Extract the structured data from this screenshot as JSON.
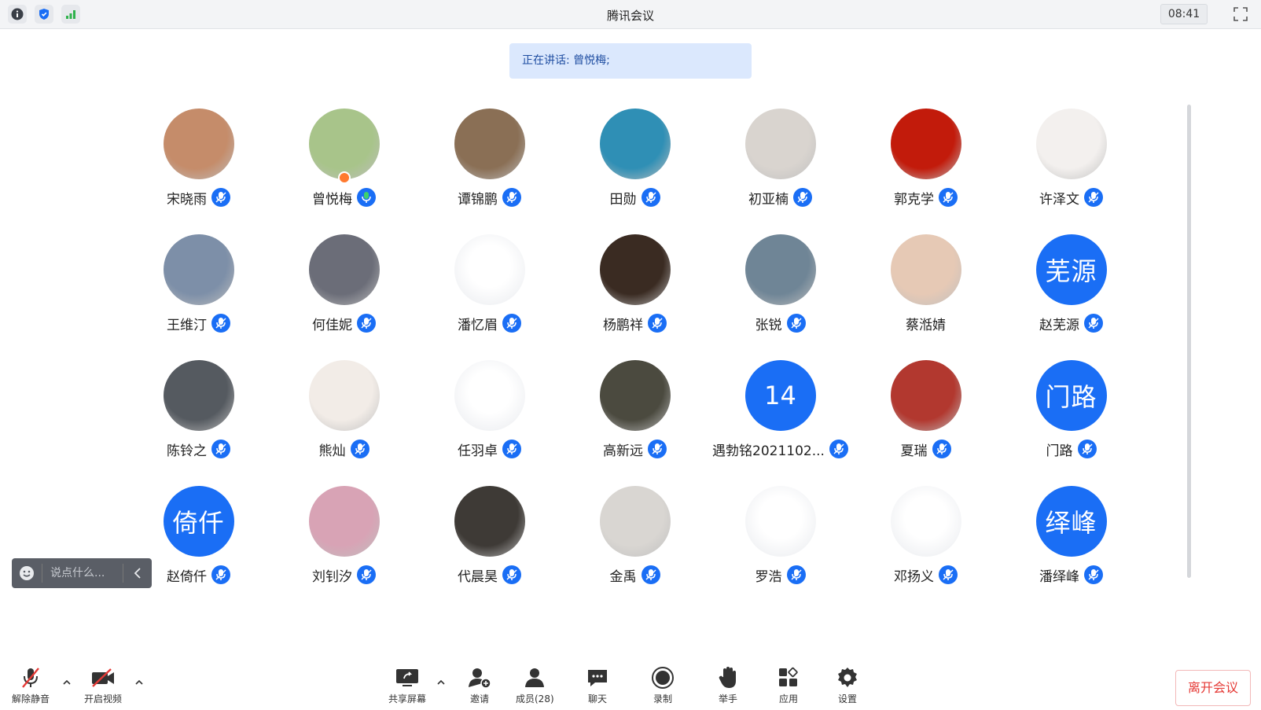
{
  "window": {
    "title": "腾讯会议",
    "clock": "08:41",
    "icons": [
      "info-icon",
      "shield-icon",
      "signal-icon",
      "fullscreen-icon"
    ]
  },
  "speaking": {
    "text": "正在讲话: 曾悦梅;"
  },
  "participants": [
    {
      "name": "宋晓雨",
      "avatar": "photo",
      "color": "#c58c6a"
    },
    {
      "name": "曾悦梅",
      "avatar": "photo",
      "color": "#a8c48a",
      "host": true
    },
    {
      "name": "谭锦鹏",
      "avatar": "photo",
      "color": "#8a6f55"
    },
    {
      "name": "田勋",
      "avatar": "photo",
      "color": "#2f8fb5"
    },
    {
      "name": "初亚楠",
      "avatar": "photo",
      "color": "#d9d4cf"
    },
    {
      "name": "郭克学",
      "avatar": "photo",
      "color": "#c21b0b"
    },
    {
      "name": "许泽文",
      "avatar": "photo",
      "color": "#f3f0ee"
    },
    {
      "name": "王维汀",
      "avatar": "photo",
      "color": "#7d8fa8"
    },
    {
      "name": "何佳妮",
      "avatar": "photo",
      "color": "#6b6d78"
    },
    {
      "name": "潘忆眉",
      "avatar": "photo",
      "color": "#f1f1f1"
    },
    {
      "name": "杨鹏祥",
      "avatar": "photo",
      "color": "#3a2b22"
    },
    {
      "name": "张锐",
      "avatar": "photo",
      "color": "#6f8596"
    },
    {
      "name": "蔡湉婧",
      "avatar": "photo",
      "color": "#e6c9b5"
    },
    {
      "name": "赵芜源",
      "avatar": "text",
      "text": "芜源",
      "color": "#1a6ef5"
    },
    {
      "name": "陈铃之",
      "avatar": "photo",
      "color": "#555a60"
    },
    {
      "name": "熊灿",
      "avatar": "photo",
      "color": "#f2ece7"
    },
    {
      "name": "任羽卓",
      "avatar": "photo",
      "color": "#ffffff"
    },
    {
      "name": "高新远",
      "avatar": "photo",
      "color": "#4b4a3f"
    },
    {
      "name": "遇勃铭2021102...",
      "avatar": "text",
      "text": "14",
      "color": "#1a6ef5"
    },
    {
      "name": "夏瑞",
      "avatar": "photo",
      "color": "#b2382f"
    },
    {
      "name": "门路",
      "avatar": "text",
      "text": "门路",
      "color": "#1a6ef5"
    },
    {
      "name": "赵倚仟",
      "avatar": "text",
      "text": "倚仟",
      "color": "#1a6ef5"
    },
    {
      "name": "刘钊汐",
      "avatar": "photo",
      "color": "#d8a3b5"
    },
    {
      "name": "代晨昊",
      "avatar": "photo",
      "color": "#3e3a36"
    },
    {
      "name": "金禹",
      "avatar": "photo",
      "color": "#d9d6d2"
    },
    {
      "name": "罗浩",
      "avatar": "photo",
      "color": "#ffffff"
    },
    {
      "name": "邓扬义",
      "avatar": "photo",
      "color": "#ffffff"
    },
    {
      "name": "潘绎峰",
      "avatar": "text",
      "text": "绎峰",
      "color": "#1a6ef5"
    }
  ],
  "chat": {
    "placeholder": "说点什么..."
  },
  "toolbar": {
    "unmute": "解除静音",
    "start_video": "开启视频",
    "share_screen": "共享屏幕",
    "invite": "邀请",
    "members": "成员(28)",
    "chat": "聊天",
    "record": "录制",
    "raise_hand": "举手",
    "apps": "应用",
    "settings": "设置",
    "leave": "离开会议"
  },
  "colors": {
    "accent": "#1a6ef5",
    "danger": "#e53935",
    "banner": "#dbe8fd"
  }
}
